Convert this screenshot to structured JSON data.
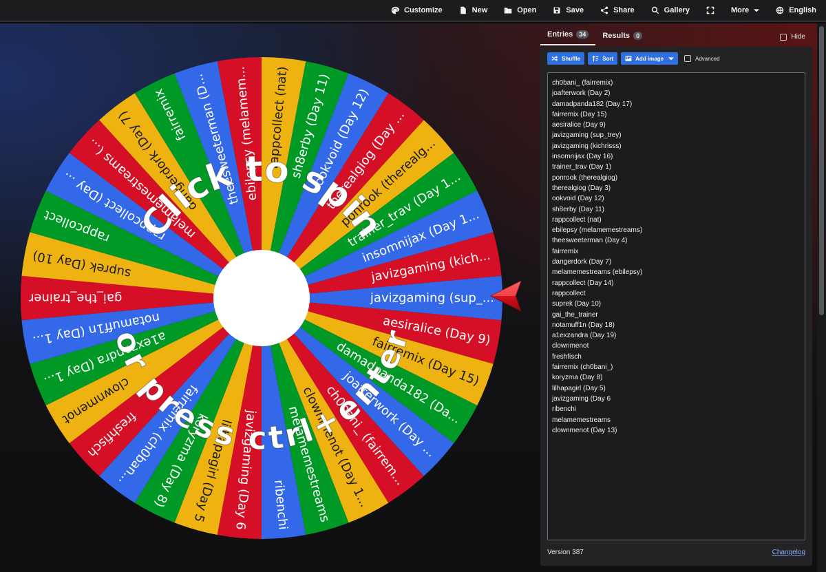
{
  "topbar": {
    "items": [
      {
        "label": "Customize",
        "icon": "palette-icon"
      },
      {
        "label": "New",
        "icon": "file-icon"
      },
      {
        "label": "Open",
        "icon": "folder-icon"
      },
      {
        "label": "Save",
        "icon": "save-icon"
      },
      {
        "label": "Share",
        "icon": "share-icon"
      },
      {
        "label": "Gallery",
        "icon": "search-icon"
      },
      {
        "label": "",
        "icon": "fullscreen-icon"
      },
      {
        "label": "More",
        "icon": "chevron-down-icon"
      },
      {
        "label": "English",
        "icon": "globe-icon"
      }
    ]
  },
  "wheel": {
    "colors": [
      "#3369e8",
      "#d50f25",
      "#eeb211",
      "#009925"
    ],
    "center_color": "#ffffff",
    "prompt_top": "Click to spin",
    "prompt_bottom": "or press ctrl+enter",
    "segments": [
      "javizgaming (sup_...",
      "aesiralice (Day 9)",
      "fairremix (Day 15)",
      "damadpanda182 (Da...",
      "joafterwork (Day ...",
      "ch0bani_ (fairrem...",
      "clownmenot (Day 1...",
      "melamemestreams",
      "ribenchi",
      "javizgaming (Day 6",
      "lilhapagirl (Day 5",
      "koryzma (Day 8)",
      "fairremix (ch0ban...",
      "freshfisch",
      "clownmenot",
      "a1exzandra (Day 1...",
      "notamuff1n (Day 1...",
      "gai_the_trainer",
      "suprek (Day 10)",
      "rappcollect",
      "rappcollect (Day ...",
      "melamemestreams (...",
      "dangerdork (Day 7)",
      "fairremix",
      "theesweeterman (D...",
      "ebilepsy (melamem...",
      "rappcollect (nat)",
      "sh8erby (Day 11)",
      "ookvoid (Day 12)",
      "therealgiog (Day ...",
      "ponrook (therealg...",
      "trainer_trav (Day 1...",
      "insomnijax (Day 1...",
      "javizgaming (kich..."
    ]
  },
  "panel": {
    "tab_entries": "Entries",
    "tab_entries_count": "34",
    "tab_results": "Results",
    "tab_results_count": "0",
    "hide_label": "Hide",
    "shuffle_label": "Shuffle",
    "sort_label": "Sort",
    "add_image_label": "Add image",
    "advanced_label": "Advanced",
    "entries": [
      "ch0bani_ (fairremix)",
      "joafterwork (Day 2)",
      "damadpanda182 (Day 17)",
      "fairremix (Day 15)",
      "aesiralice (Day 9)",
      "javizgaming (sup_trey)",
      "javizgaming (kichrisss)",
      "insomnijax (Day 16)",
      "trainer_trav (Day 1)",
      "ponrook (therealgiog)",
      "therealgiog (Day 3)",
      "ookvoid (Day 12)",
      "sh8erby (Day 11)",
      "rappcollect (nat)",
      "ebilepsy (melamemestreams)",
      "theesweeterman (Day 4)",
      "fairremix",
      "dangerdork (Day 7)",
      "melamemestreams (ebilepsy)",
      "rappcollect (Day 14)",
      "rappcollect",
      "suprek (Day 10)",
      "gai_the_trainer",
      "notamuff1n (Day 18)",
      "a1exzandra (Day 19)",
      "clownmenot",
      "freshfisch",
      "fairremix (ch0bani_)",
      "koryzma (Day 8)",
      "lilhapagirl (Day 5)",
      "javizgaming (Day 6",
      "ribenchi",
      "melamemestreams",
      "clownmenot (Day 13)"
    ],
    "version": "Version 387",
    "changelog": "Changelog"
  }
}
